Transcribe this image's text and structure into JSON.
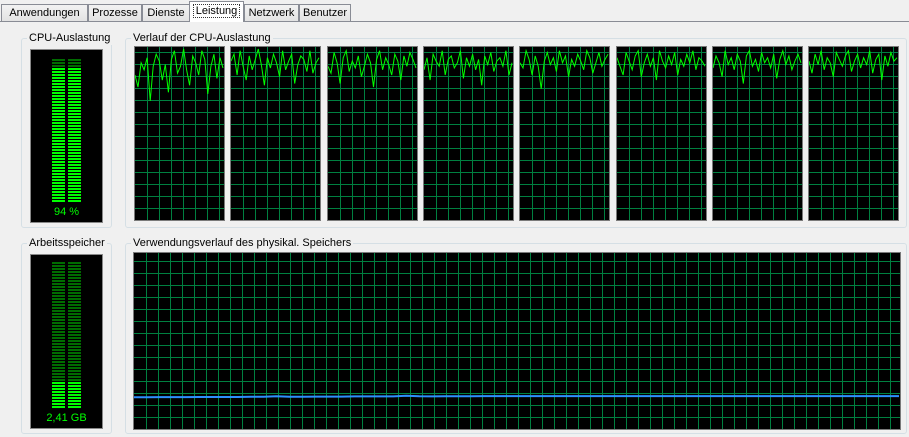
{
  "tabs": [
    "Anwendungen",
    "Prozesse",
    "Dienste",
    "Leistung",
    "Netzwerk",
    "Benutzer"
  ],
  "active_tab": "Leistung",
  "cpu_usage": {
    "label": "CPU-Auslastung",
    "value_text": "94 %",
    "percent": 94
  },
  "cpu_history": {
    "label": "Verlauf der CPU-Auslastung",
    "core_count": 8,
    "line_color": "#00ff00",
    "grid_color": "#008040",
    "samples_per_core": [
      [
        85,
        78,
        92,
        88,
        95,
        70,
        90,
        97,
        93,
        82,
        91,
        75,
        94,
        99,
        86,
        90,
        100,
        88,
        79,
        96,
        92,
        85,
        99,
        94,
        74,
        90,
        97,
        83,
        95,
        89
      ],
      [
        93,
        97,
        85,
        99,
        90,
        82,
        96,
        88,
        94,
        100,
        91,
        79,
        95,
        89,
        97,
        92,
        84,
        99,
        88,
        93,
        97,
        80,
        91,
        96,
        94,
        87,
        99,
        86,
        92,
        95
      ],
      [
        90,
        86,
        98,
        92,
        80,
        95,
        99,
        87,
        93,
        89,
        96,
        84,
        90,
        97,
        92,
        78,
        94,
        99,
        88,
        95,
        91,
        85,
        97,
        93,
        82,
        96,
        90,
        98,
        94,
        89
      ],
      [
        88,
        95,
        82,
        97,
        93,
        90,
        99,
        85,
        94,
        96,
        89,
        92,
        99,
        83,
        95,
        90,
        97,
        88,
        94,
        79,
        96,
        91,
        98,
        87,
        93,
        95,
        90,
        99,
        85,
        92
      ],
      [
        92,
        89,
        99,
        94,
        85,
        96,
        90,
        77,
        93,
        98,
        91,
        95,
        87,
        99,
        92,
        96,
        84,
        94,
        90,
        97,
        93,
        88,
        99,
        95,
        86,
        92,
        98,
        90,
        94,
        97
      ],
      [
        95,
        90,
        85,
        98,
        93,
        88,
        96,
        99,
        84,
        92,
        97,
        90,
        95,
        82,
        99,
        93,
        89,
        96,
        91,
        98,
        85,
        94,
        90,
        97,
        92,
        99,
        88,
        95,
        93,
        90
      ],
      [
        89,
        96,
        92,
        84,
        99,
        91,
        95,
        88,
        97,
        93,
        80,
        96,
        99,
        90,
        94,
        87,
        98,
        92,
        95,
        89,
        97,
        83,
        94,
        99,
        91,
        96,
        88,
        93,
        97,
        92
      ],
      [
        93,
        86,
        97,
        91,
        99,
        88,
        95,
        92,
        84,
        98,
        94,
        90,
        96,
        99,
        87,
        93,
        97,
        89,
        95,
        91,
        99,
        86,
        94,
        97,
        82,
        96,
        90,
        98,
        93,
        95
      ]
    ]
  },
  "memory": {
    "label": "Arbeitsspeicher",
    "value_text": "2,41 GB",
    "fraction": 0.18
  },
  "memory_history": {
    "label": "Verwendungsverlauf des physikal. Speichers",
    "line_color": "#2e8fff",
    "samples": [
      18.0,
      18.0,
      18.1,
      18.1,
      18.1,
      18.2,
      18.2,
      18.2,
      18.2,
      18.3,
      18.3,
      18.6,
      18.3,
      18.3,
      18.4,
      18.4,
      18.4,
      18.5,
      18.5,
      18.5,
      18.5,
      18.9,
      18.6,
      18.5,
      18.6,
      18.6,
      18.6,
      18.7,
      18.7,
      18.7,
      18.7,
      18.7,
      18.7,
      18.7,
      18.7,
      18.7,
      18.7,
      18.7,
      18.7,
      18.7,
      18.7,
      18.7,
      18.7,
      18.7,
      18.7,
      18.7,
      18.7,
      18.7,
      18.7,
      18.7,
      18.7,
      18.7,
      18.7,
      18.7,
      18.7,
      18.7,
      18.7,
      18.7,
      18.7,
      18.7
    ]
  }
}
